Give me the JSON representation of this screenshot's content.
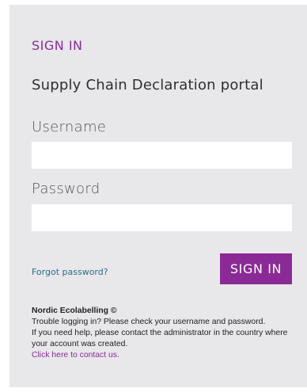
{
  "login": {
    "heading": "SIGN IN",
    "subtitle": "Supply Chain Declaration portal",
    "username_label": "Username",
    "username_value": "",
    "password_label": "Password",
    "password_value": "",
    "forgot_password": "Forgot password?",
    "signin_button": "SIGN IN"
  },
  "footer": {
    "brand": "Nordic Ecolabelling ©",
    "line1": "Trouble logging in? Please check your username and password.",
    "line2": "If you need help, please contact the administrator in the country where your account was created.",
    "contact_link": "Click here to contact us."
  },
  "colors": {
    "accent": "#8b2a96",
    "card_background": "#e8e7ea",
    "link": "#2a6e8a"
  }
}
